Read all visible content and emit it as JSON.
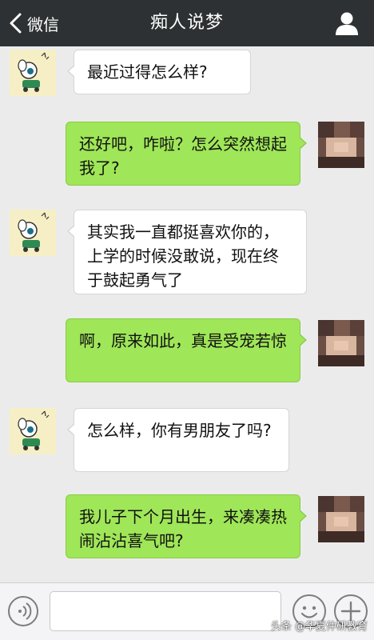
{
  "header": {
    "back_label": "微信",
    "title": "痴人说梦"
  },
  "messages": [
    {
      "side": "left",
      "text": "最近过得怎么样?"
    },
    {
      "side": "right",
      "text": "还好吧，咋啦？怎么突然想起我了?"
    },
    {
      "side": "left",
      "text": "其实我一直都挺喜欢你的，上学的时候没敢说，现在终于鼓起勇气了"
    },
    {
      "side": "right",
      "text": "啊，原来如此，真是受宠若惊"
    },
    {
      "side": "left",
      "text": "怎么样，你有男朋友了吗?"
    },
    {
      "side": "right",
      "text": "我儿子下个月出生，来凑凑热闹沾沾喜气吧?"
    }
  ],
  "input": {
    "value": "",
    "placeholder": ""
  },
  "watermark": "头条 @华夏仲研教育",
  "colors": {
    "header_bg": "#2e3133",
    "chat_bg": "#ebebeb",
    "bubble_green": "#9fe658",
    "bubble_white": "#ffffff"
  },
  "icons": {
    "back": "chevron-left-icon",
    "profile": "person-icon",
    "voice": "voice-icon",
    "emoji": "smiley-icon",
    "plus": "plus-icon"
  }
}
